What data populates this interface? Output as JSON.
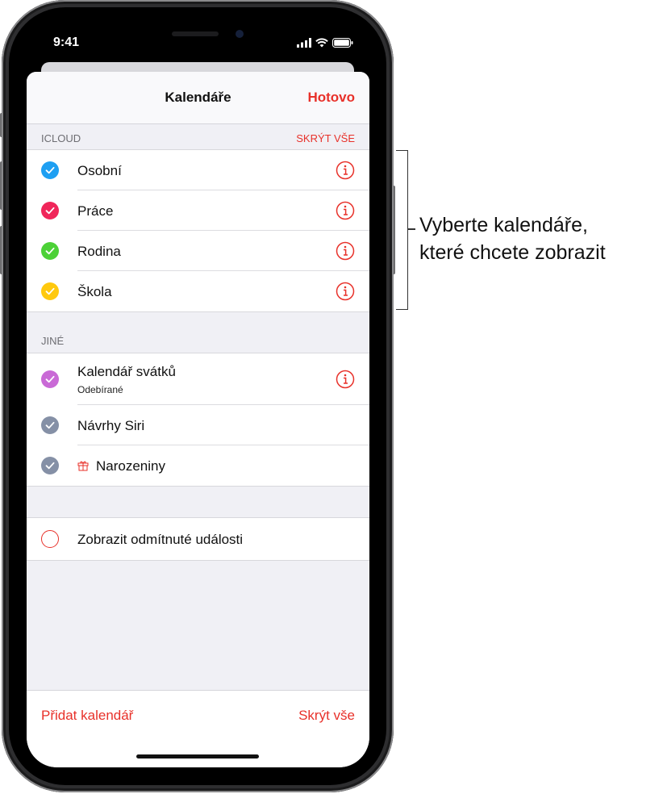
{
  "status_bar": {
    "time": "9:41"
  },
  "nav": {
    "title": "Kalendáře",
    "done": "Hotovo"
  },
  "icloud": {
    "header": "ICLOUD",
    "action": "SKRÝT VŠE",
    "items": [
      {
        "label": "Osobní",
        "color": "#1e9ff2"
      },
      {
        "label": "Práce",
        "color": "#f0265a"
      },
      {
        "label": "Rodina",
        "color": "#4cd137"
      },
      {
        "label": "Škola",
        "color": "#ffc90e"
      }
    ]
  },
  "other": {
    "header": "JINÉ",
    "items": [
      {
        "label": "Kalendář svátků",
        "sub": "Odebírané",
        "color": "#c96ad6"
      },
      {
        "label": "Návrhy Siri",
        "color": "#8590a6"
      },
      {
        "label": "Narozeniny",
        "color": "#8590a6",
        "icon": "gift-icon"
      }
    ]
  },
  "declined": {
    "label": "Zobrazit odmítnuté události"
  },
  "toolbar": {
    "add": "Přidat kalendář",
    "hide_all": "Skrýt vše"
  },
  "callout": {
    "line1": "Vyberte kalendáře,",
    "line2": "které chcete zobrazit"
  },
  "accent": "#e8312a"
}
